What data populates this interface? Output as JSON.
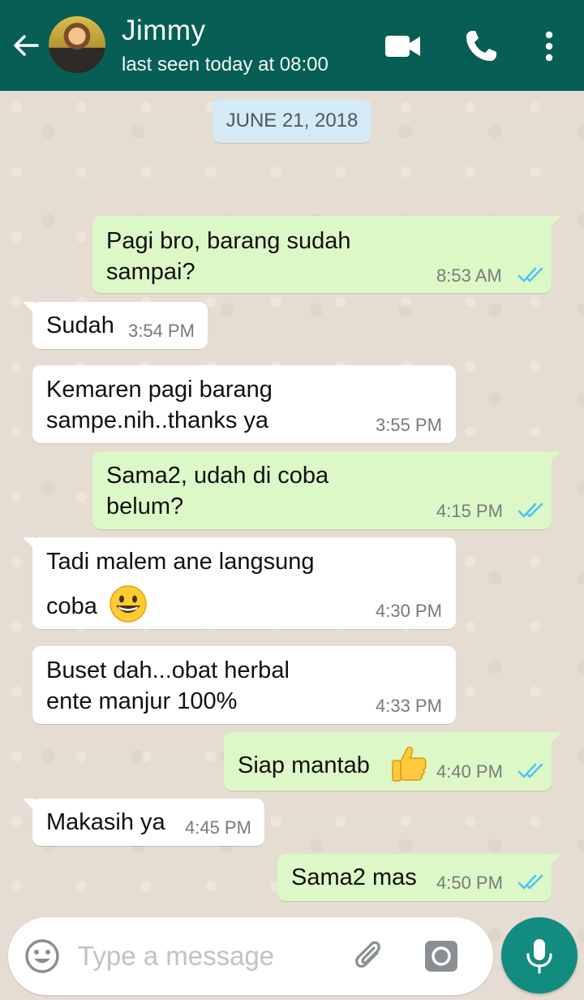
{
  "header": {
    "contact_name": "Jimmy",
    "status": "last seen today at 08:00",
    "icons": [
      "back-arrow-icon",
      "avatar",
      "video-call-icon",
      "phone-call-icon",
      "more-options-icon"
    ],
    "color": "#075e54"
  },
  "date_divider": "JUNE 21, 2018",
  "messages": [
    {
      "direction": "out",
      "lines": [
        "Pagi bro, barang sudah",
        "sampai?"
      ],
      "time": "8:53 AM",
      "read": true
    },
    {
      "direction": "in",
      "lines": [
        "Sudah"
      ],
      "time": "3:54 PM"
    },
    {
      "direction": "in",
      "lines": [
        "Kemaren pagi barang",
        "sampe.nih..thanks ya"
      ],
      "time": "3:55 PM"
    },
    {
      "direction": "out",
      "lines": [
        "Sama2, udah di coba",
        "belum?"
      ],
      "time": "4:15 PM",
      "read": true
    },
    {
      "direction": "in",
      "lines": [
        "Tadi malem ane langsung",
        "coba"
      ],
      "emoji": "grinning-face-emoji",
      "time": "4:30 PM"
    },
    {
      "direction": "in",
      "lines": [
        "Buset dah...obat herbal",
        "ente manjur 100%"
      ],
      "time": "4:33 PM"
    },
    {
      "direction": "out",
      "lines": [
        "Siap mantab"
      ],
      "emoji": "thumbs-up-emoji",
      "time": "4:40 PM",
      "read": true
    },
    {
      "direction": "in",
      "lines": [
        "Makasih ya"
      ],
      "time": "4:45 PM"
    },
    {
      "direction": "out",
      "lines": [
        "Sama2 mas"
      ],
      "time": "4:50 PM",
      "read": true
    }
  ],
  "composer": {
    "placeholder": "Type a message",
    "icons": [
      "emoji-icon",
      "attach-icon",
      "camera-icon",
      "mic-icon"
    ]
  },
  "colors": {
    "outgoing_bubble": "#dcf8c6",
    "incoming_bubble": "#ffffff",
    "read_ticks": "#4fc3f7",
    "mic_button": "#128c7e"
  }
}
